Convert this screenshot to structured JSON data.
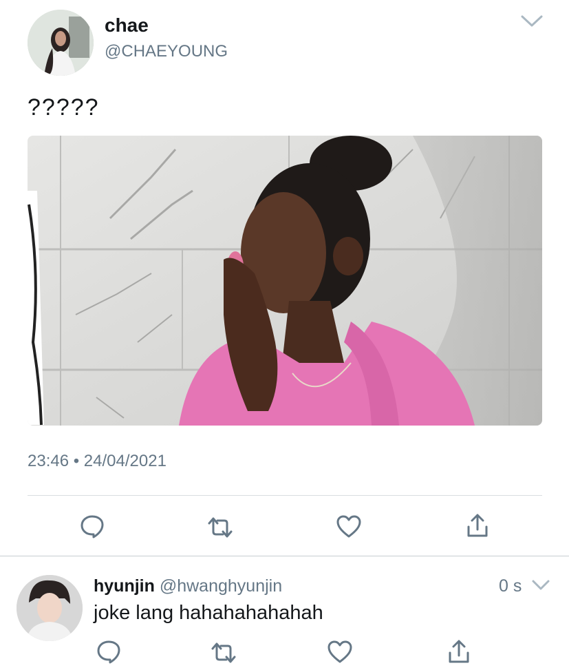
{
  "main_tweet": {
    "author_name": "chae",
    "author_handle": "@CHAEYOUNG",
    "text": "?????",
    "timestamp": "23:46 • 24/04/2021",
    "actions": [
      "reply-icon",
      "retweet-icon",
      "like-icon",
      "share-icon"
    ]
  },
  "reply_tweet": {
    "author_name": "hyunjin",
    "author_handle": "@hwanghyunjin",
    "text": "joke lang hahahahahahah",
    "time_ago": "0 s",
    "actions": [
      "reply-icon",
      "retweet-icon",
      "like-icon",
      "share-icon"
    ]
  },
  "colors": {
    "text_primary": "#14171a",
    "text_muted": "#657786",
    "divider": "#d8dde0",
    "icon": "#657786"
  }
}
